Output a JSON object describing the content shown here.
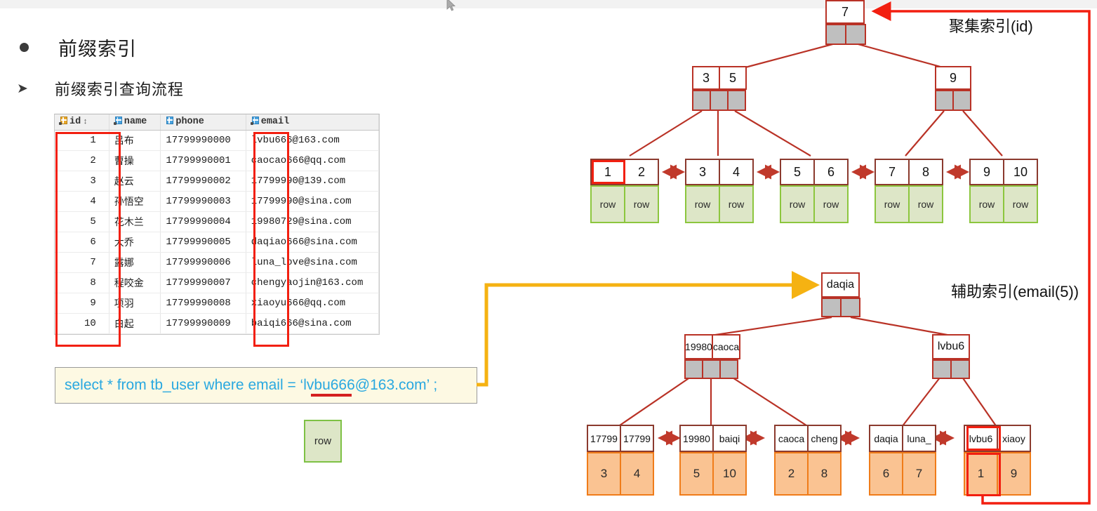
{
  "slide": {
    "heading1": "前缀索引",
    "heading2": "前缀索引查询流程"
  },
  "grid": {
    "columns": [
      {
        "label": "id",
        "icon": "primary-key-icon",
        "sortable": true,
        "sort_glyph": "↕"
      },
      {
        "label": "name",
        "icon": "column-grid-icon",
        "sortable": false
      },
      {
        "label": "phone",
        "icon": "column-grid-plain-icon",
        "sortable": false
      },
      {
        "label": "email",
        "icon": "column-grid-icon",
        "sortable": false
      }
    ],
    "rows": [
      {
        "id": "1",
        "name": "吕布",
        "phone": "17799990000",
        "email": "lvbu666@163.com"
      },
      {
        "id": "2",
        "name": "曹操",
        "phone": "17799990001",
        "email": "caocao666@qq.com"
      },
      {
        "id": "3",
        "name": "赵云",
        "phone": "17799990002",
        "email": "17799990@139.com"
      },
      {
        "id": "4",
        "name": "孙悟空",
        "phone": "17799990003",
        "email": "17799990@sina.com"
      },
      {
        "id": "5",
        "name": "花木兰",
        "phone": "17799990004",
        "email": "19980729@sina.com"
      },
      {
        "id": "6",
        "name": "大乔",
        "phone": "17799990005",
        "email": "daqiao666@sina.com"
      },
      {
        "id": "7",
        "name": "露娜",
        "phone": "17799990006",
        "email": "luna_love@sina.com"
      },
      {
        "id": "8",
        "name": "程咬金",
        "phone": "17799990007",
        "email": "chengyaojin@163.com"
      },
      {
        "id": "9",
        "name": "项羽",
        "phone": "17799990008",
        "email": "xiaoyu666@qq.com"
      },
      {
        "id": "10",
        "name": "白起",
        "phone": "17799990009",
        "email": "baiqi666@sina.com"
      }
    ]
  },
  "sql": {
    "text": "select * from tb_user where email = ‘lvbu666@163.com’ ;"
  },
  "standalone_row_box": {
    "label": "row"
  },
  "clustered_index": {
    "title": "聚集索引(id)",
    "root": {
      "keys": [
        "7"
      ]
    },
    "level2": [
      {
        "keys": [
          "3",
          "5"
        ]
      },
      {
        "keys": [
          "9"
        ]
      }
    ],
    "leaves": [
      {
        "keys": [
          "1",
          "2"
        ],
        "rows": [
          "row",
          "row"
        ]
      },
      {
        "keys": [
          "3",
          "4"
        ],
        "rows": [
          "row",
          "row"
        ]
      },
      {
        "keys": [
          "5",
          "6"
        ],
        "rows": [
          "row",
          "row"
        ]
      },
      {
        "keys": [
          "7",
          "8"
        ],
        "rows": [
          "row",
          "row"
        ]
      },
      {
        "keys": [
          "9",
          "10"
        ],
        "rows": [
          "row",
          "row"
        ]
      }
    ],
    "highlighted_leaf_key": "1"
  },
  "secondary_index": {
    "title": "辅助索引(email(5))",
    "root": {
      "keys": [
        "daqia"
      ]
    },
    "level2": [
      {
        "keys": [
          "19980",
          "caoca"
        ]
      },
      {
        "keys": [
          "lvbu6"
        ]
      }
    ],
    "leaves": [
      {
        "keys": [
          "17799",
          "17799"
        ],
        "rows": [
          "3",
          "4"
        ]
      },
      {
        "keys": [
          "19980",
          "baiqi"
        ],
        "rows": [
          "5",
          "10"
        ]
      },
      {
        "keys": [
          "caoca",
          "cheng"
        ],
        "rows": [
          "2",
          "8"
        ]
      },
      {
        "keys": [
          "daqia",
          "luna_"
        ],
        "rows": [
          "6",
          "7"
        ]
      },
      {
        "keys": [
          "lvbu6",
          "xiaoy"
        ],
        "rows": [
          "1",
          "9"
        ]
      }
    ],
    "highlighted_leaf_key": "lvbu6",
    "highlighted_leaf_row": "1"
  },
  "colors": {
    "node_border": "#b93226",
    "pointer_fill": "#bfbfbf",
    "row_green_fill": "#dde6c7",
    "row_green_border": "#8cc63e",
    "row_orange_fill": "#fac392",
    "row_orange_border": "#f07c19",
    "highlight_red": "#f21f10",
    "arrow_yellow": "#f5b212",
    "sql_text": "#29a8e0",
    "sql_bg": "#fdf9e3"
  }
}
